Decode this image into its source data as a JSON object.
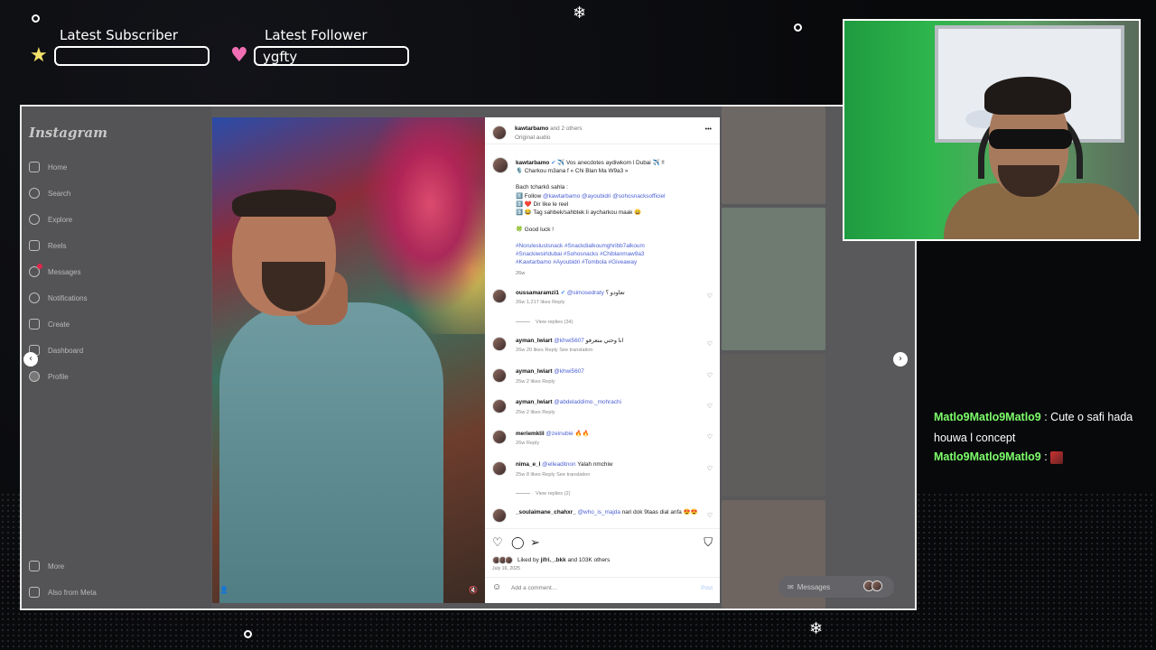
{
  "overlay": {
    "latest_subscriber_label": "Latest Subscriber",
    "latest_subscriber_value": "",
    "latest_follower_label": "Latest Follower",
    "latest_follower_value": "ygfty",
    "star_icon": "★",
    "heart_icon": "♥"
  },
  "instagram": {
    "logo": "Instagram",
    "nav": [
      {
        "label": "Home"
      },
      {
        "label": "Search"
      },
      {
        "label": "Explore"
      },
      {
        "label": "Reels"
      },
      {
        "label": "Messages"
      },
      {
        "label": "Notifications"
      },
      {
        "label": "Create"
      },
      {
        "label": "Dashboard"
      },
      {
        "label": "Profile"
      }
    ],
    "nav_bottom": [
      {
        "label": "More"
      },
      {
        "label": "Also from Meta"
      }
    ],
    "messages_pill": "Messages"
  },
  "post": {
    "header_user": "kawtarbamo",
    "header_others": "and 2 others",
    "audio": "Original audio",
    "more_icon": "•••",
    "caption": {
      "user": "kawtarbamo",
      "line1": "✈️ Vos anecdotes aydiwkom l Dubai ✈️ !!",
      "line2": "🎙️ Charkou m3ana f « Chi Blan Ma W9a3 »",
      "line3": "Bach tcharkô sahla :",
      "step1": "1️⃣ Follow",
      "step1_tags": "@kawtarbamo @ayoubidri @sohosnacksofficiel",
      "step2": "2️⃣ ❤️ Dir like le reel",
      "step3": "3️⃣ 😂 Tag sahbek/sahbtek li aycharkou maak 😄",
      "good_luck": "🍀 Good luck !",
      "hashtags1": "#Noruleslustsnack #Snackdialkoumghribb7alkoum",
      "hashtags2": "#Snackiwsirldubai #Sohosnacks #Chiblanmaw9a3",
      "hashtags3": "#Kawtarbamo #Ayoubidri #Tombola #Giveaway",
      "time": "26w"
    },
    "comments": [
      {
        "user": "oussamaramzi1",
        "mention": "@simosedraty",
        "text": "تعاودو ؟",
        "meta": "26w   1,217 likes   Reply",
        "replies": "View replies (34)"
      },
      {
        "user": "ayman_lwiart",
        "mention": "@khwi5607",
        "text": "انا وحتي متعرفو",
        "meta": "26w   20 likes   Reply   See translation"
      },
      {
        "user": "ayman_lwiart",
        "mention": "@khwi5607",
        "text": "",
        "meta": "25w   2 likes   Reply"
      },
      {
        "user": "ayman_lwiart",
        "mention": "@abdeladdimo._mohrachi",
        "text": "",
        "meta": "25w   2 likes   Reply"
      },
      {
        "user": "meriemklil",
        "mention": "@zeinubie",
        "text": "🔥🔥",
        "meta": "26w   Reply"
      },
      {
        "user": "nima_e_l",
        "mention": "@elleaditnon",
        "text": "Yalah nmchiw",
        "meta": "25w   8 likes   Reply   See translation",
        "replies": "View replies (2)"
      },
      {
        "user": "_soulaimane_chahxr_",
        "mention": "@who_is_majda",
        "text": "nari dok 9taas dial anfa 😍😍",
        "meta": ""
      }
    ],
    "liked_by": "Liked by",
    "liked_user": "jifri._.bkk",
    "liked_others": "and 103K others",
    "date": "July 16, 2025",
    "comment_placeholder": "Add a comment…",
    "post_button": "Post"
  },
  "chat": [
    {
      "name": "Matlo9Matlo9Matlo9",
      "message": " : Cute o safi hada houwa l concept"
    },
    {
      "name": "Matlo9Matlo9Matlo9",
      "message": " : "
    }
  ]
}
